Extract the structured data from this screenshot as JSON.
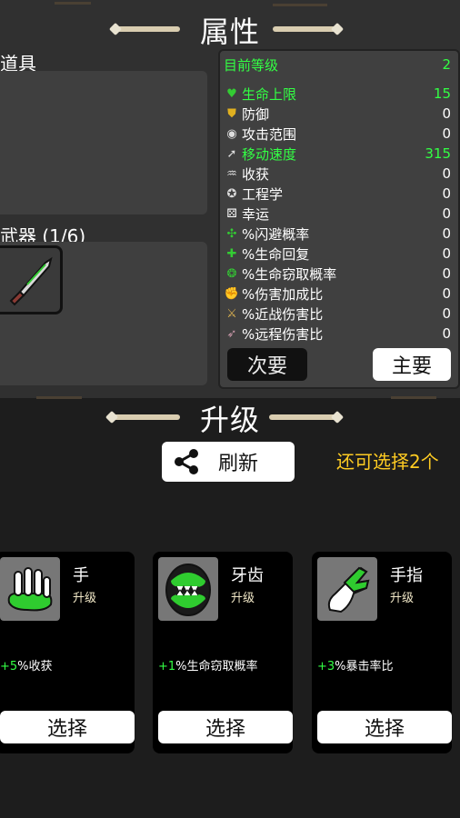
{
  "attributes": {
    "title": "属性",
    "items_label": "道具",
    "weapons_label": "武器 (1/6)",
    "level_label": "目前等级",
    "level_value": "2",
    "stats": [
      {
        "icon": "heart-icon",
        "name": "生命上限",
        "value": "15",
        "highlight": true
      },
      {
        "icon": "shield-icon",
        "name": "防御",
        "value": "0",
        "highlight": false
      },
      {
        "icon": "target-icon",
        "name": "攻击范围",
        "value": "0",
        "highlight": false
      },
      {
        "icon": "boot-icon",
        "name": "移动速度",
        "value": "315",
        "highlight": true
      },
      {
        "icon": "harvest-icon",
        "name": "收获",
        "value": "0",
        "highlight": false
      },
      {
        "icon": "wrench-icon",
        "name": "工程学",
        "value": "0",
        "highlight": false
      },
      {
        "icon": "dice-icon",
        "name": "幸运",
        "value": "0",
        "highlight": false
      },
      {
        "icon": "dodge-icon",
        "name": "%闪避概率",
        "value": "0",
        "highlight": false
      },
      {
        "icon": "regen-icon",
        "name": "%生命回复",
        "value": "0",
        "highlight": false
      },
      {
        "icon": "lifesteal-icon",
        "name": "%生命窃取概率",
        "value": "0",
        "highlight": false
      },
      {
        "icon": "muscle-icon",
        "name": "%伤害加成比",
        "value": "0",
        "highlight": false
      },
      {
        "icon": "sword-icon",
        "name": "%近战伤害比",
        "value": "0",
        "highlight": false
      },
      {
        "icon": "ranged-icon",
        "name": "%远程伤害比",
        "value": "0",
        "highlight": false
      }
    ],
    "tab_secondary": "次要",
    "tab_primary": "主要"
  },
  "upgrade": {
    "title": "升级",
    "refresh_label": "刷新",
    "remaining": "还可选择2个",
    "cards": [
      {
        "icon": "hand-icon",
        "name": "手",
        "level": "升级",
        "bonus_num": "+5",
        "bonus_text": "%收获",
        "select": "选择"
      },
      {
        "icon": "teeth-icon",
        "name": "牙齿",
        "level": "升级",
        "bonus_num": "+1",
        "bonus_text": "%生命窃取概率",
        "select": "选择"
      },
      {
        "icon": "finger-icon",
        "name": "手指",
        "level": "升级",
        "bonus_num": "+3",
        "bonus_text": "%暴击率比",
        "select": "选择"
      }
    ]
  },
  "colors": {
    "highlight_green": "#33ff44",
    "remaining_yellow": "#ffcc22",
    "panel_bg": "#303030",
    "card_bg": "#000000"
  }
}
